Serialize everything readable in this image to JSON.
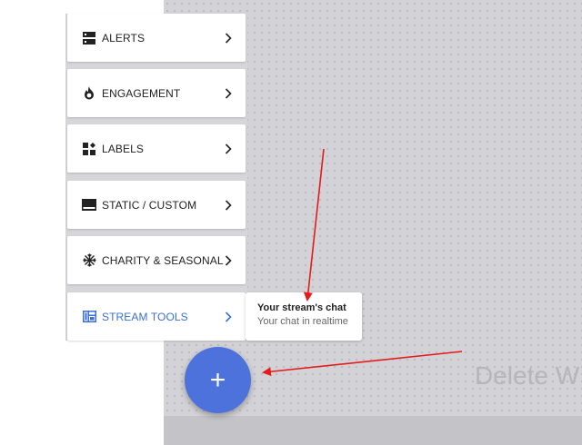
{
  "menu": {
    "items": [
      {
        "label": "ALERTS",
        "icon": "alerts-icon"
      },
      {
        "label": "ENGAGEMENT",
        "icon": "flame-icon"
      },
      {
        "label": "LABELS",
        "icon": "labels-icon"
      },
      {
        "label": "STATIC / CUSTOM",
        "icon": "static-custom-icon"
      },
      {
        "label": "CHARITY & SEASONAL",
        "icon": "snowflake-icon"
      },
      {
        "label": "STREAM TOOLS",
        "icon": "stream-tools-icon",
        "active": true
      }
    ]
  },
  "tooltip": {
    "title": "Your stream's chat",
    "subtitle": "Your chat in realtime"
  },
  "fab": {
    "symbol": "+"
  },
  "canvas": {
    "delete_text": "Delete W"
  },
  "colors": {
    "accent": "#4d72db",
    "active_text": "#3b6fd8",
    "arrow": "#e31b1b",
    "canvas_bg": "#d3d3d7"
  }
}
